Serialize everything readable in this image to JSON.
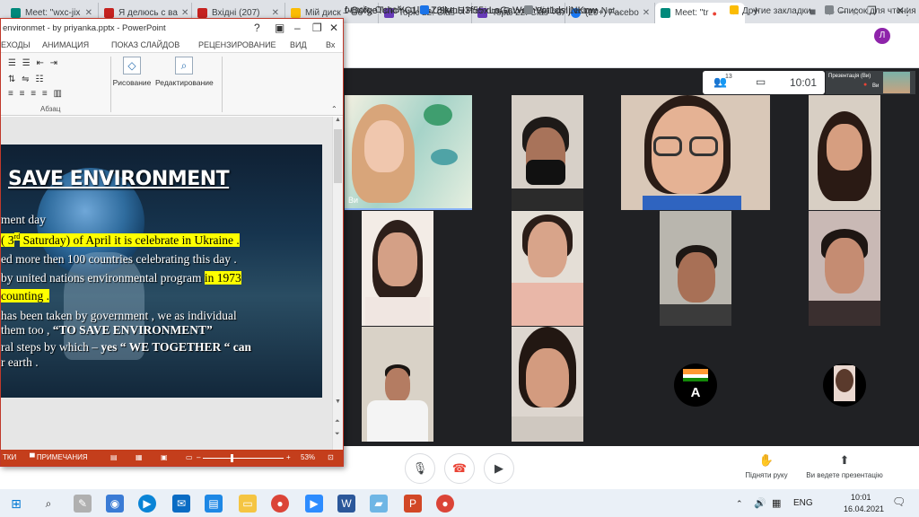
{
  "browser": {
    "tabs": [
      {
        "title": "Meet: \"wxc-jix",
        "fav_color": "#00897b"
      },
      {
        "title": "Я делюсь с ва",
        "fav_color": "#c5221f"
      },
      {
        "title": "Вхідні (207)",
        "fav_color": "#c5221f"
      },
      {
        "title": "Мій диск – Go",
        "fav_color": "#fbbc04"
      },
      {
        "title": "Topic 22. Clas",
        "fav_color": "#673ab7"
      },
      {
        "title": "Topic 22. Clas",
        "fav_color": "#673ab7"
      },
      {
        "title": "(20+) Facebo",
        "fav_color": "#1877f2"
      },
      {
        "title": "Meet: \"tr",
        "fav_color": "#00897b"
      }
    ],
    "new_tab": "+",
    "minimize": "–",
    "restore": "❐",
    "close": "✕",
    "url": "f-OofgeTchcYC1lkAZ8lkmH3f55xLaGcWemVot1dsIjNKnw",
    "profile_initial": "Л",
    "bookmarks": [
      "ологія. Онлайн-п...",
      "USMLE Previous Qu...",
      "Biology Lecture Not...",
      "Другие закладки",
      "Список для чтения"
    ]
  },
  "meet": {
    "participants_count": "13",
    "time": "10:01",
    "self_label": "Презентація (Ви)",
    "self_name_short": "Ви",
    "you_label": "Ви",
    "tile_initial": "A",
    "controls": {
      "raise_hand": "Підняти руку",
      "presenting": "Ви ведете презентацію"
    }
  },
  "ppt": {
    "title": "environmet - by priyanka.pptx - PowerPoint",
    "help": "?",
    "ribbon_tabs": [
      "ЕХОДЫ",
      "АНИМАЦИЯ",
      "ПОКАЗ СЛАЙДОВ",
      "РЕЦЕНЗИРОВАНИЕ",
      "ВИД",
      "Вх"
    ],
    "group_paragraph": "Абзац",
    "btn_draw": "Рисование",
    "btn_edit": "Редактирование",
    "slide": {
      "title": "SAVE ENVIRONMENT",
      "line1": "ment day",
      "line2_a": "( 3",
      "line2_sup": "rd",
      "line2_b": " Saturday) of April it is celebrate in Ukraine .",
      "line3": "ed more then 100 countries celebrating this day .",
      "line4_a": "by united nations environmental program ",
      "line4_hl": "in 1973",
      "line5": "counting .",
      "line6": "has been taken by government , we as individual",
      "line7_a": "them too , ",
      "line7_b": "“TO SAVE ENVIRONMENT”",
      "line8_a": "ral steps by which – ",
      "line8_b": "yes “ WE TOGETHER “ can",
      "line9": "r earth ."
    },
    "status": {
      "notes_left": "ТКИ",
      "notes": "ПРИМЕЧАНИЯ",
      "zoom": "53%"
    }
  },
  "taskbar": {
    "lang": "ENG",
    "time": "10:01",
    "date": "16.04.2021"
  }
}
